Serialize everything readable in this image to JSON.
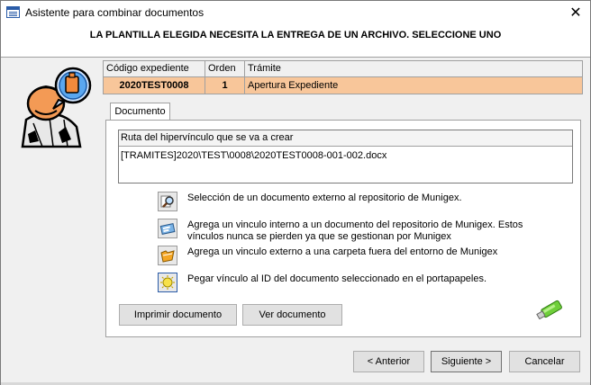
{
  "window": {
    "title": "Asistente para combinar documentos",
    "close_glyph": "✕"
  },
  "header": {
    "text": "LA PLANTILLA ELEGIDA NECESITA LA ENTREGA DE UN ARCHIVO. SELECCIONE UNO"
  },
  "info_table": {
    "columns": [
      "Código expediente",
      "Orden",
      "Trámite"
    ],
    "row": [
      "2020TEST0008",
      "1",
      "Apertura Expediente"
    ],
    "row_highlight_color": "#f8c69a"
  },
  "tabs": [
    {
      "label": "Documento",
      "selected": true
    }
  ],
  "route": {
    "label": "Ruta del hipervínculo que se va a crear",
    "value": "[TRAMITES]2020\\TEST\\0008\\2020TEST0008-001-002.docx"
  },
  "options": [
    {
      "icon": "magnifier-icon",
      "text": "Selección de un documento externo al repositorio de Munigex."
    },
    {
      "icon": "repository-link-icon",
      "text": "Agrega un vinculo interno a un documento del repositorio de Munigex. Estos vínculos nunca se pierden ya que se gestionan por Munigex"
    },
    {
      "icon": "folder-link-icon",
      "text": "Agrega un vinculo externo a una carpeta fuera del entorno de Munigex"
    },
    {
      "icon": "clipboard-id-icon",
      "text": "Pegar vínculo al ID del documento seleccionado en el portapapeles."
    }
  ],
  "buttons": {
    "print": "Imprimir documento",
    "view": "Ver documento",
    "back": "< Anterior",
    "next": "Siguiente >",
    "cancel": "Cancelar"
  }
}
